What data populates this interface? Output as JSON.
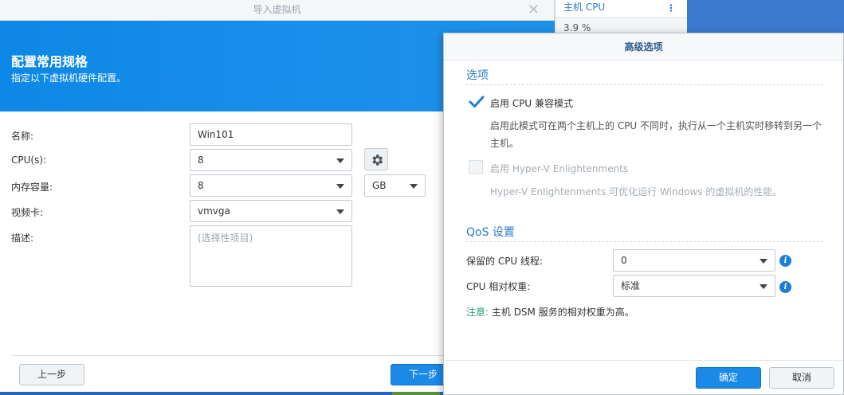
{
  "background": {
    "panel_header": "主机 CPU",
    "panel_value": "3.9 %",
    "menu_icon": "more-vertical-icon"
  },
  "wizard": {
    "title": "导入虚拟机",
    "banner_title": "配置常用规格",
    "banner_subtitle": "指定以下虚拟机硬件配置。",
    "fields": {
      "name_label": "名称:",
      "name_value": "Win101",
      "cpu_label": "CPU(s):",
      "cpu_value": "8",
      "memory_label": "内存容量:",
      "memory_value": "8",
      "memory_unit": "GB",
      "video_label": "视频卡:",
      "video_value": "vmvga",
      "desc_label": "描述:",
      "desc_placeholder": "(选择性项目)"
    },
    "prev_button": "上一步",
    "next_button": "下一步"
  },
  "advanced": {
    "title": "高级选项",
    "options_section": "选项",
    "cpu_compat_label": "启用 CPU 兼容模式",
    "cpu_compat_checked": true,
    "cpu_compat_desc_line1": "启用此模式可在两个主机上的 CPU 不同时，执行从一个主机实时移转到另一个",
    "cpu_compat_desc_line2": "主机。",
    "hyperv_label": "启用 Hyper-V Enlightenments",
    "hyperv_checked": false,
    "hyperv_desc": "Hyper-V Enlightenments 可优化运行 Windows 的虚拟机的性能。",
    "qos_section": "QoS 设置",
    "reserved_label": "保留的 CPU 线程:",
    "reserved_value": "0",
    "weight_label": "CPU 相对权重:",
    "weight_value": "标准",
    "note_label": "注意:",
    "note_text": "主机 DSM 服务的相对权重为高。",
    "ok_button": "确定",
    "cancel_button": "取消"
  },
  "colors": {
    "accent": "#1a8ae6",
    "banner": "#0d88e6",
    "section_title": "#2a7bc9",
    "note": "#2a9d6e"
  }
}
